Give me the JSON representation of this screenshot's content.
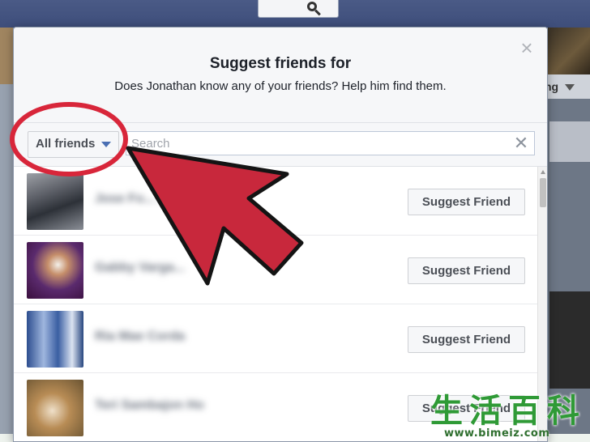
{
  "dialog": {
    "title": "Suggest friends for",
    "subtitle": "Does Jonathan know any of your friends? Help him find them.",
    "close_icon": "close-icon"
  },
  "filter": {
    "dropdown_label": "All friends",
    "search_placeholder": "Search",
    "search_value": "",
    "clear_icon": "close-icon"
  },
  "friends": [
    {
      "name": "Jose Fo... ...ata",
      "button": "Suggest Friend"
    },
    {
      "name": "Gabby Varga...",
      "button": "Suggest Friend"
    },
    {
      "name": "Ria Mae Corda",
      "button": "Suggest Friend"
    },
    {
      "name": "Teri Sambajon Ho",
      "button": "Suggest Friend"
    }
  ],
  "background": {
    "right_tab_label": "ng"
  },
  "annotations": {
    "highlight_color": "#d8263a",
    "arrow_color": "#c8283c"
  },
  "watermark": {
    "glyphs": [
      "生",
      "活",
      "百",
      "科"
    ],
    "url": "www.bimeiz.com"
  },
  "colors": {
    "topbar": "#3e4e7b",
    "button_text": "#4b4f56",
    "caret": "#4a6fb3"
  }
}
